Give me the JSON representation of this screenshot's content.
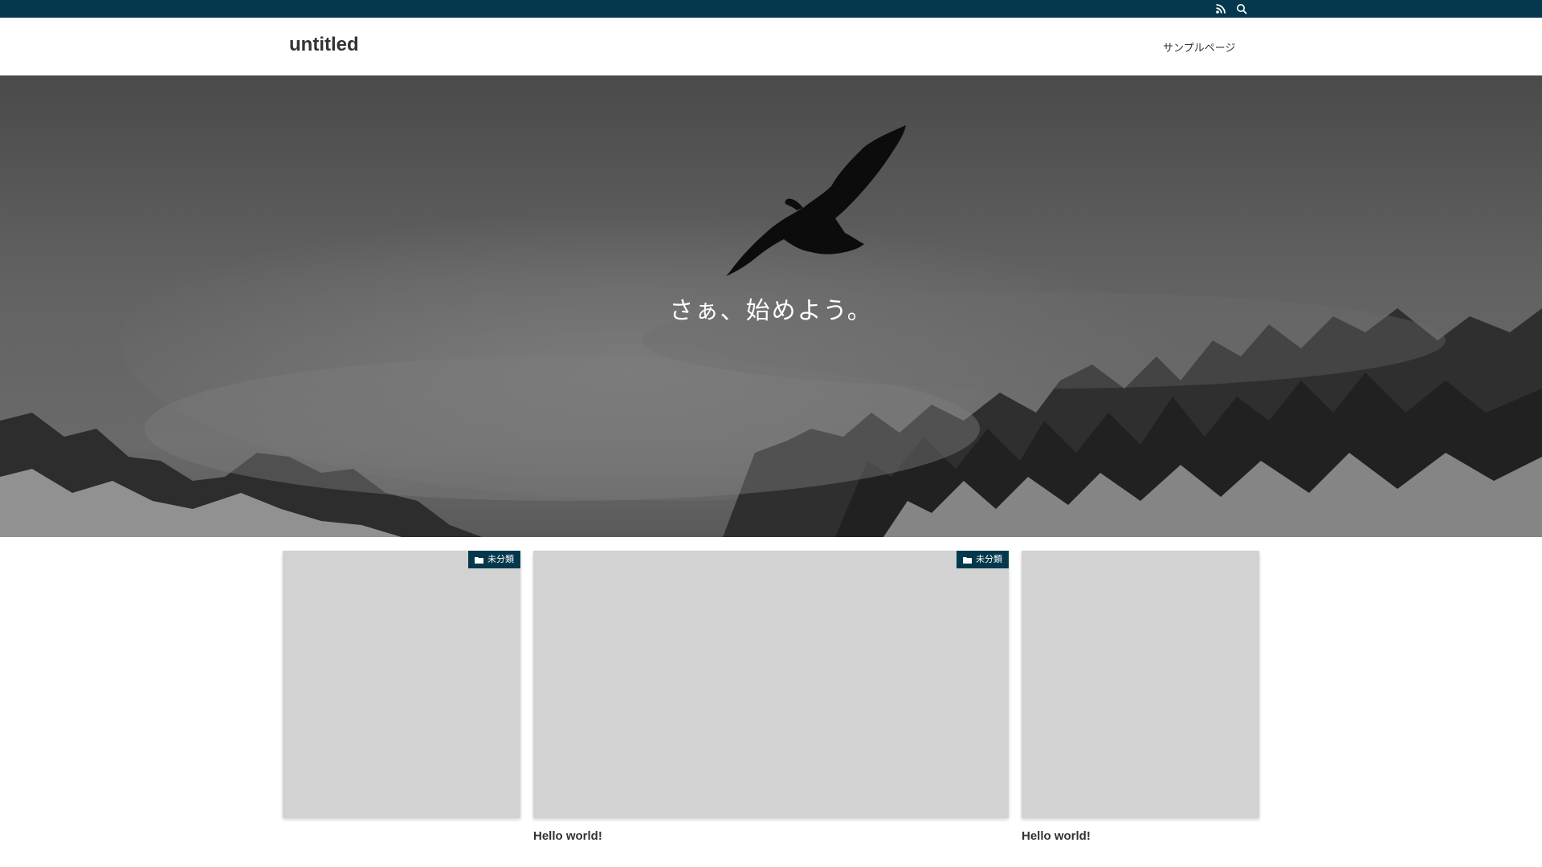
{
  "site": {
    "title": "untitled"
  },
  "topbar": {
    "icons": [
      "rss-icon",
      "search-icon"
    ],
    "color": "#04384c"
  },
  "nav": {
    "items": [
      {
        "label": "サンプルページ"
      }
    ]
  },
  "hero": {
    "tagline": "さぁ、始めよう。",
    "image": "bird-over-misty-mountains"
  },
  "posts": [
    {
      "category": "未分類",
      "title": ""
    },
    {
      "category": "未分類",
      "title": "Hello world!"
    },
    {
      "category": "",
      "title": "Hello world!"
    }
  ],
  "colors": {
    "accent": "#04384c",
    "placeholder": "#d2d2d2"
  }
}
